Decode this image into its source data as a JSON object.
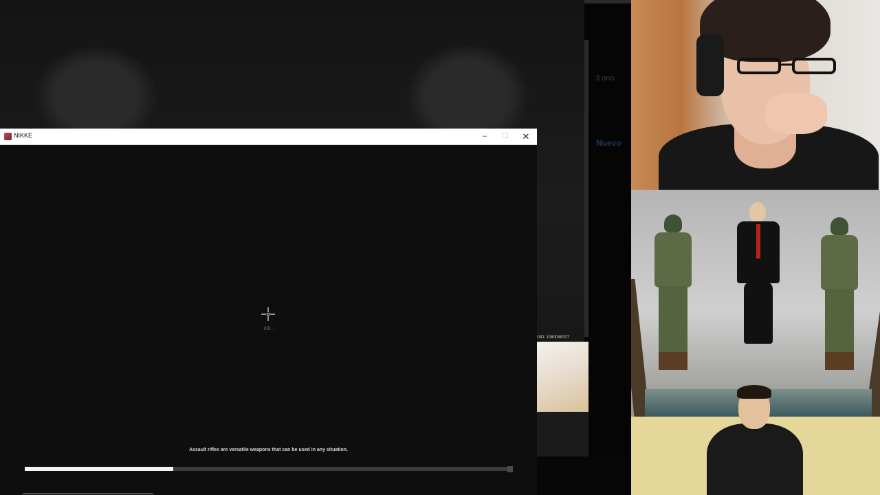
{
  "background": {
    "side_text_top": "3 ono",
    "side_text_link": "Nuevo",
    "uid_label": "UID: 1080048707"
  },
  "window": {
    "title": "NIKKE",
    "icon": "nikke-app-icon",
    "minimize_glyph": "–",
    "maximize_glyph": "☐",
    "close_glyph": "✕"
  },
  "loading": {
    "spinner_icon": "crosshair-loading-icon",
    "label": "ılılı..",
    "tip": "Assault rifles are versatile weapons that can be used in any situation.",
    "progress": 0.305
  },
  "webcam": {
    "description_icon": "streamer-webcam"
  },
  "comic": {
    "icon": "comic-panel-image"
  }
}
